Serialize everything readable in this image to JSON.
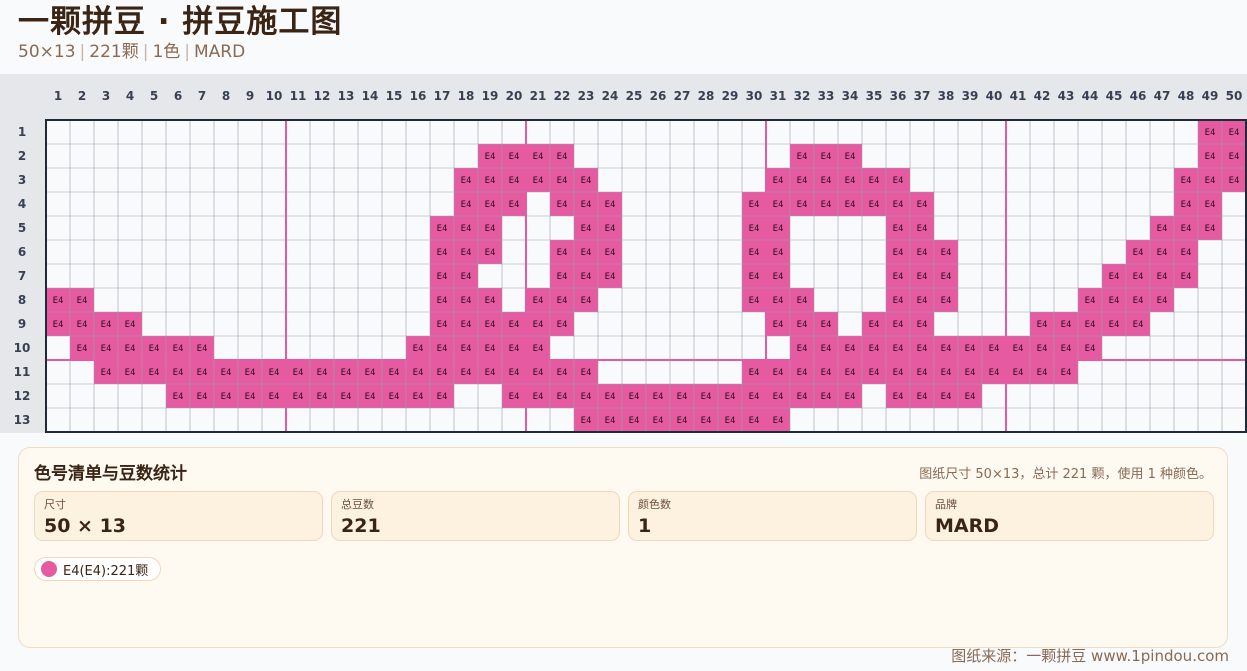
{
  "header": {
    "title": "一颗拼豆 · 拼豆施工图",
    "size": "50×13",
    "count": "221颗",
    "colors": "1色",
    "brand": "MARD"
  },
  "pattern": {
    "columns": 50,
    "rows": 13,
    "bead_label": "E4",
    "bead_color": "#e55aa0",
    "row_cells": [
      [
        49,
        50
      ],
      [
        19,
        20,
        21,
        22,
        32,
        33,
        34,
        49,
        50
      ],
      [
        18,
        19,
        20,
        21,
        22,
        23,
        31,
        32,
        33,
        34,
        35,
        36,
        48,
        49,
        50
      ],
      [
        18,
        19,
        20,
        22,
        23,
        24,
        30,
        31,
        32,
        33,
        34,
        35,
        36,
        37,
        48,
        49
      ],
      [
        17,
        18,
        19,
        23,
        24,
        30,
        31,
        36,
        37,
        47,
        48,
        49
      ],
      [
        17,
        18,
        19,
        22,
        23,
        24,
        30,
        31,
        36,
        37,
        38,
        46,
        47,
        48
      ],
      [
        17,
        18,
        22,
        23,
        24,
        30,
        31,
        36,
        37,
        38,
        45,
        46,
        47,
        48
      ],
      [
        1,
        2,
        17,
        18,
        19,
        21,
        22,
        23,
        30,
        31,
        32,
        36,
        37,
        38,
        44,
        45,
        46,
        47
      ],
      [
        1,
        2,
        3,
        4,
        17,
        18,
        19,
        20,
        21,
        22,
        31,
        32,
        33,
        35,
        36,
        37,
        42,
        43,
        44,
        45,
        46
      ],
      [
        2,
        3,
        4,
        5,
        6,
        7,
        16,
        17,
        18,
        19,
        20,
        21,
        32,
        33,
        34,
        35,
        36,
        37,
        38,
        39,
        40,
        41,
        42,
        43,
        44
      ],
      [
        3,
        4,
        5,
        6,
        7,
        8,
        9,
        10,
        11,
        12,
        13,
        14,
        15,
        16,
        17,
        18,
        19,
        20,
        21,
        22,
        23,
        30,
        31,
        32,
        33,
        34,
        35,
        36,
        37,
        38,
        39,
        40,
        41,
        42,
        43
      ],
      [
        6,
        7,
        8,
        9,
        10,
        11,
        12,
        13,
        14,
        15,
        16,
        17,
        20,
        21,
        22,
        23,
        24,
        25,
        26,
        27,
        28,
        29,
        30,
        31,
        32,
        33,
        34,
        36,
        37,
        38,
        39
      ],
      [
        23,
        24,
        25,
        26,
        27,
        28,
        29,
        30,
        31
      ]
    ]
  },
  "panel": {
    "title": "色号清单与豆数统计",
    "summary": "图纸尺寸 50×13，总计 221 颗，使用 1 种颜色。",
    "stats": [
      {
        "label": "尺寸",
        "value": "50 × 13"
      },
      {
        "label": "总豆数",
        "value": "221"
      },
      {
        "label": "颜色数",
        "value": "1"
      },
      {
        "label": "品牌",
        "value": "MARD"
      }
    ],
    "legend": [
      {
        "label": "E4(E4):221颗",
        "color": "#e55aa0"
      }
    ]
  },
  "footer": {
    "source": "图纸来源：一颗拼豆 www.1pindou.com"
  }
}
